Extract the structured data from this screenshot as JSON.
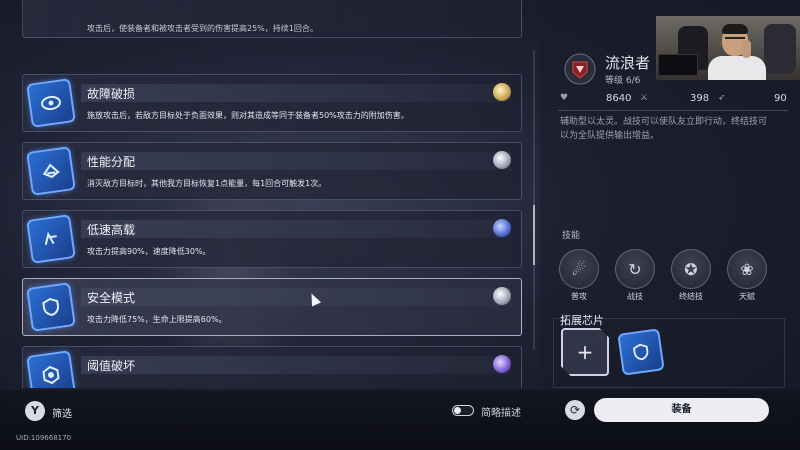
{
  "chip_list": {
    "top_partial_desc": "攻击后，使装备者和被攻击者受到的伤害提高25%，持续1回合。",
    "items": [
      {
        "name": "故障破损",
        "desc": "施放攻击后，若敌方目标处于负面效果，则对其造成等同于装备者50%攻击力的附加伤害。",
        "medal": "gold"
      },
      {
        "name": "性能分配",
        "desc": "消灭敌方目标时，其他我方目标恢复1点能量，每1回合可触发1次。",
        "medal": "silver"
      },
      {
        "name": "低速高载",
        "desc": "攻击力提高90%，速度降低30%。",
        "medal": "blue"
      },
      {
        "name": "安全模式",
        "desc": "攻击力降低75%，生命上限提高60%。",
        "medal": "silver"
      },
      {
        "name": "阈值破坏",
        "desc": "",
        "medal": "purple"
      }
    ]
  },
  "character": {
    "name": "流浪者",
    "level": "等级 6/6",
    "hp": "8640",
    "attack": "398",
    "speed": "90",
    "bio": "辅助型以太灵。战技可以使队友立即行动，终结技可以为全队提供输出增益。"
  },
  "skills": {
    "label": "技能",
    "items": [
      {
        "label": "普攻",
        "icon": "meteor-icon"
      },
      {
        "label": "战技",
        "icon": "refresh-icon"
      },
      {
        "label": "终结技",
        "icon": "badge-icon"
      },
      {
        "label": "天赋",
        "icon": "lotus-icon"
      }
    ]
  },
  "chips": {
    "label": "拓展芯片",
    "add_symbol": "+"
  },
  "bottom": {
    "filter_label": "筛选",
    "filter_icon": "Y",
    "toggle_label": "简略描述",
    "equip_label": "装备",
    "swap_icon": "⟳",
    "uid": "UID:109668170"
  },
  "colors": {
    "chip_blue": "#2b6fd6",
    "accent_white": "#eceef3"
  }
}
